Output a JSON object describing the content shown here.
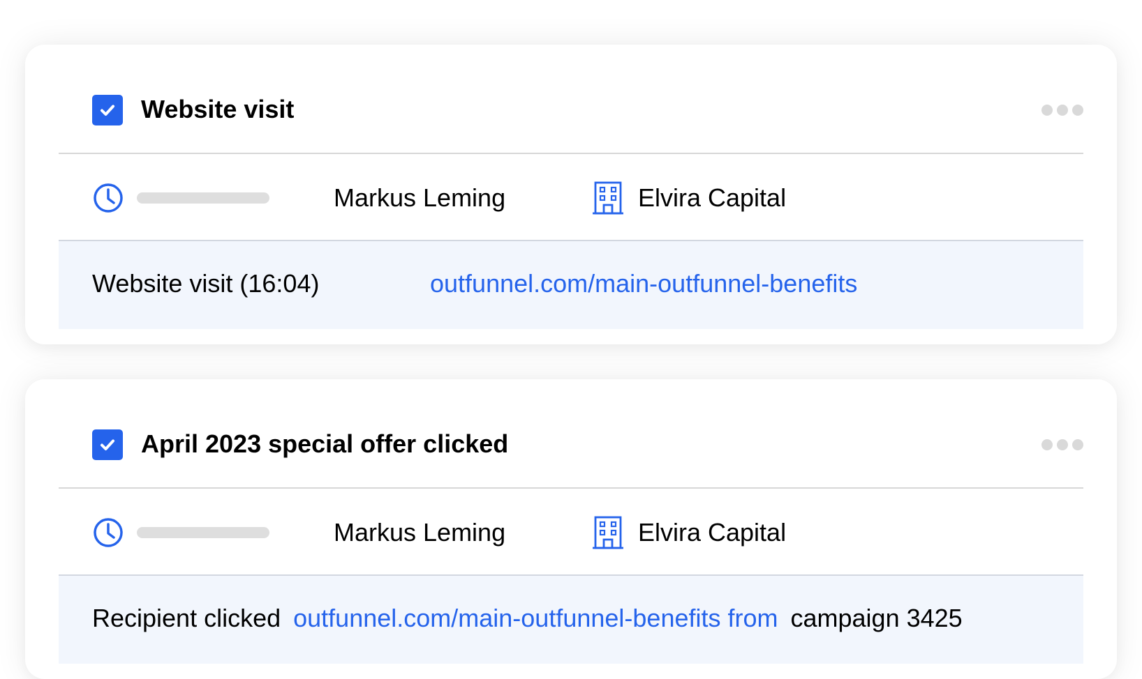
{
  "cards": [
    {
      "title": "Website visit",
      "person": "Markus Leming",
      "company": "Elvira Capital",
      "detail_label": "Website visit (16:04)",
      "detail_link": "outfunnel.com/main-outfunnel-benefits"
    },
    {
      "title": "April 2023 special offer clicked",
      "person": "Markus Leming",
      "company": "Elvira Capital",
      "detail_prefix": "Recipient clicked",
      "detail_link": "outfunnel.com/main-outfunnel-benefits from",
      "detail_suffix": "campaign 3425"
    }
  ],
  "icons": {
    "checkbox": "check-icon",
    "clock": "clock-icon",
    "company": "building-icon",
    "more": "more-horizontal-icon"
  },
  "colors": {
    "accent": "#2563eb",
    "detail_background": "#f2f6fd",
    "placeholder": "#dedede",
    "divider": "#d7d7d7"
  }
}
